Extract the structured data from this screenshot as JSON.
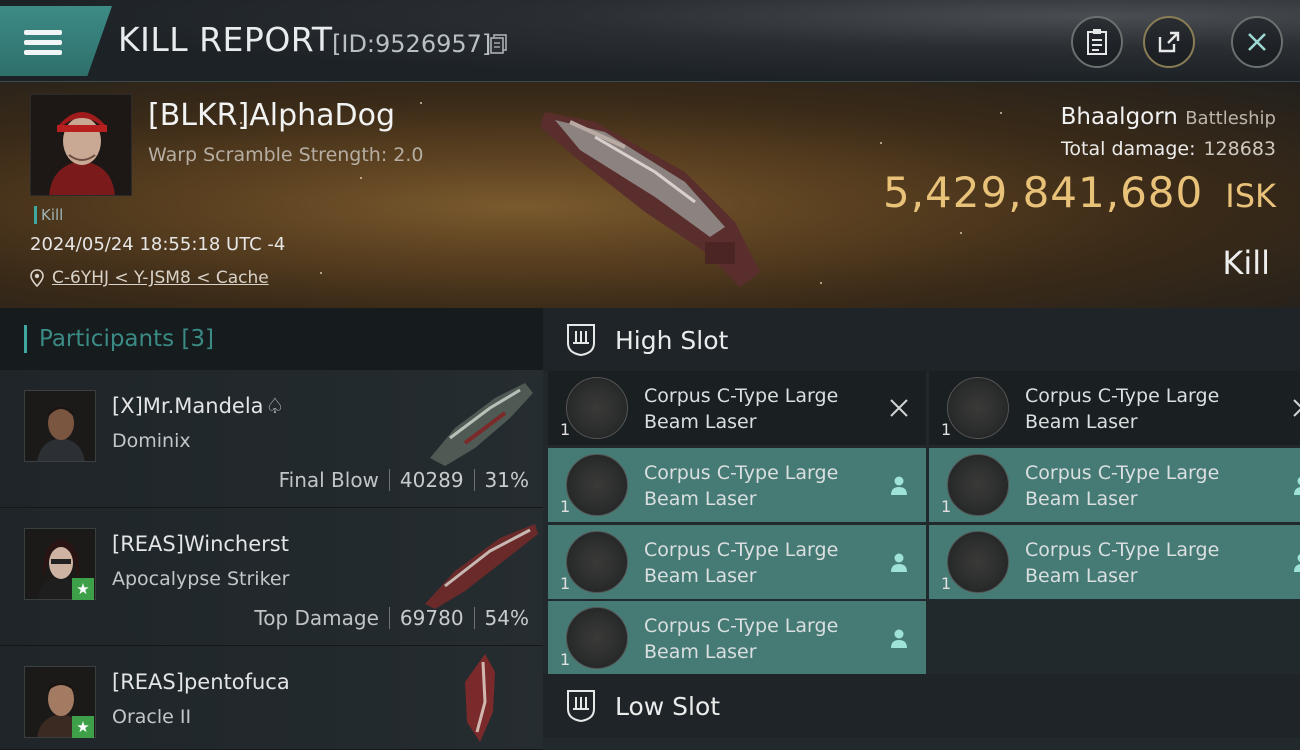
{
  "header": {
    "title": "KILL REPORT",
    "report_id": "[ID:9526957]"
  },
  "victim": {
    "name": "[BLKR]AlphaDog",
    "warp_scramble": "Warp Scramble Strength: 2.0",
    "kill_tag": "Kill",
    "datetime": "2024/05/24 18:55:18 UTC -4",
    "location": "C-6YHJ < Y-JSM8 < Cache",
    "ship": "Bhaalgorn",
    "ship_class": "Battleship",
    "total_damage_label": "Total damage:",
    "total_damage": "128683",
    "isk_value": "5,429,841,680",
    "isk_label": "ISK",
    "result": "Kill"
  },
  "participants": {
    "title": "Participants",
    "count": "[3]",
    "items": [
      {
        "name": "[X]Mr.Mandela",
        "ship": "Dominix",
        "stat_label": "Final Blow",
        "damage": "40289",
        "percent": "31%",
        "badge": false
      },
      {
        "name": "[REAS]Wincherst",
        "ship": "Apocalypse Striker",
        "stat_label": "Top Damage",
        "damage": "69780",
        "percent": "54%",
        "badge": true
      },
      {
        "name": "[REAS]pentofuca",
        "ship": "Oracle II",
        "stat_label": "",
        "damage": "",
        "percent": "",
        "badge": true
      }
    ]
  },
  "slots": {
    "high": {
      "label": "High Slot",
      "modules": [
        {
          "name": "Corpus C-Type Large Beam Laser",
          "qty": "1",
          "state": "destroyed"
        },
        {
          "name": "Corpus C-Type Large Beam Laser",
          "qty": "1",
          "state": "destroyed"
        },
        {
          "name": "Corpus C-Type Large Beam Laser",
          "qty": "1",
          "state": "dropped"
        },
        {
          "name": "Corpus C-Type Large Beam Laser",
          "qty": "1",
          "state": "dropped"
        },
        {
          "name": "Corpus C-Type Large Beam Laser",
          "qty": "1",
          "state": "dropped"
        },
        {
          "name": "Corpus C-Type Large Beam Laser",
          "qty": "1",
          "state": "dropped"
        },
        {
          "name": "Corpus C-Type Large Beam Laser",
          "qty": "1",
          "state": "dropped"
        }
      ]
    },
    "low": {
      "label": "Low Slot"
    }
  },
  "colors": {
    "accent_teal": "#3fa79f",
    "isk_gold": "#e9c27a",
    "dropped_bg": "#467a74",
    "destroyed_bg": "#1a1f22"
  }
}
